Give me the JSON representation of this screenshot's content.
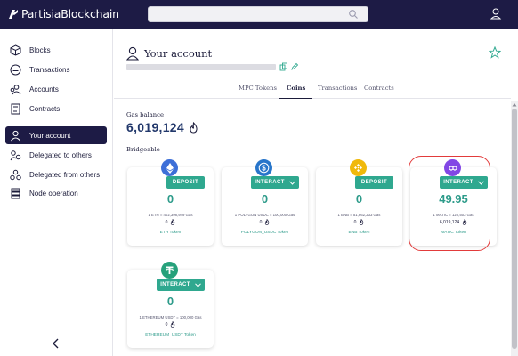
{
  "app": {
    "title": "PartisiaBlockchain"
  },
  "search": {
    "placeholder": ""
  },
  "sidebar": {
    "items": [
      {
        "label": "Blocks",
        "icon": "cube-icon"
      },
      {
        "label": "Transactions",
        "icon": "transactions-icon"
      },
      {
        "label": "Accounts",
        "icon": "accounts-icon"
      },
      {
        "label": "Contracts",
        "icon": "document-icon"
      },
      {
        "label": "Your account",
        "icon": "user-icon",
        "active": true
      },
      {
        "label": "Delegated to others",
        "icon": "delegated-icon"
      },
      {
        "label": "Delegated from others",
        "icon": "delegated-from-icon"
      },
      {
        "label": "Node operation",
        "icon": "server-icon"
      }
    ]
  },
  "account": {
    "title": "Your account",
    "tabs": [
      "MPC Tokens",
      "Coins",
      "Transactions",
      "Contracts"
    ],
    "active_tab": "Coins",
    "gas_label": "Gas balance",
    "gas_value": "6,019,124",
    "bridgeable_label": "Bridgeable"
  },
  "cards": [
    {
      "name": "E",
      "amount": "0",
      "button": "DEPOSIT",
      "rate": "1 ETH = 402,398,949 Gas",
      "gas": "0",
      "token": "ETH Token",
      "coin_color": "#3d6fd8",
      "coin_icon": "ethereum-icon"
    },
    {
      "name": "P",
      "amount": "0",
      "button": "INTERACT",
      "rate": "1 POLYGON USDC = 100,000 Gas",
      "gas": "0",
      "token": "POLYGON_USDC Token",
      "coin_color": "#2775ca",
      "coin_icon": "usdc-icon"
    },
    {
      "name": "B",
      "amount": "0",
      "button": "DEPOSIT",
      "rate": "1 BNB = 51,862,233 Gas",
      "gas": "0",
      "token": "BNB Token",
      "coin_color": "#f0b90b",
      "coin_icon": "bnb-icon"
    },
    {
      "name": "",
      "amount": "49.95",
      "button": "INTERACT",
      "rate": "1 MATIC = 120,503 Gas",
      "gas": "6,019,124",
      "token": "MATIC Token",
      "coin_color": "#8247e5",
      "coin_icon": "matic-icon"
    },
    {
      "name": "E",
      "amount": "0",
      "button": "INTERACT",
      "rate": "1 ETHEREUM USDT = 100,000 Gas",
      "gas": "0",
      "token": "ETHEREUM_USDT Token",
      "coin_color": "#26a17b",
      "coin_icon": "tether-icon"
    }
  ],
  "colors": {
    "navy": "#1d1b45",
    "accent": "#2fa88f",
    "highlight": "#e23b3b"
  }
}
